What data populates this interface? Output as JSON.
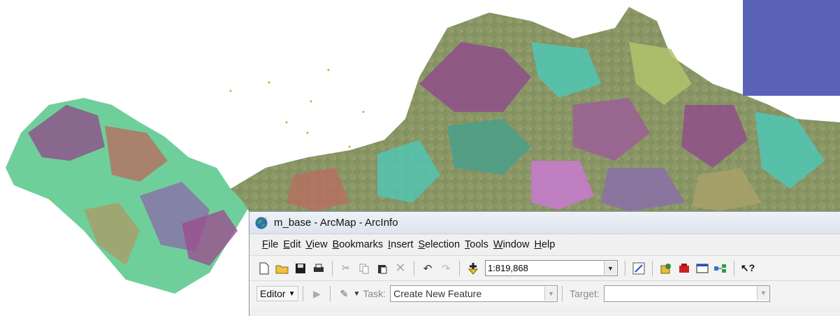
{
  "window": {
    "title": "m_base - ArcMap - ArcInfo"
  },
  "menu": [
    {
      "label": "File",
      "key": "F"
    },
    {
      "label": "Edit",
      "key": "E"
    },
    {
      "label": "View",
      "key": "V"
    },
    {
      "label": "Bookmarks",
      "key": "B"
    },
    {
      "label": "Insert",
      "key": "I"
    },
    {
      "label": "Selection",
      "key": "S"
    },
    {
      "label": "Tools",
      "key": "T"
    },
    {
      "label": "Window",
      "key": "W"
    },
    {
      "label": "Help",
      "key": "H"
    }
  ],
  "standard_toolbar": {
    "scale_value": "1:819,868",
    "icons": [
      "new-document-icon",
      "open-folder-icon",
      "save-icon",
      "print-icon",
      "cut-icon",
      "copy-icon",
      "paste-icon",
      "delete-icon",
      "undo-icon",
      "redo-icon",
      "add-data-icon"
    ],
    "right_icons": [
      "editor-toolbar-icon",
      "arccatalog-icon",
      "arctoolbox-icon",
      "python-window-icon",
      "model-builder-icon",
      "whats-this-icon"
    ]
  },
  "editor_toolbar": {
    "editor_label": "Editor",
    "task_label": "Task:",
    "task_value": "Create New Feature",
    "target_label": "Target:"
  },
  "colors": {
    "overlay_block": "#5a62b8",
    "geology_purple": "#8e4f8a",
    "geology_cyan": "#4fc7b5",
    "geology_olive": "#9aa56b"
  }
}
